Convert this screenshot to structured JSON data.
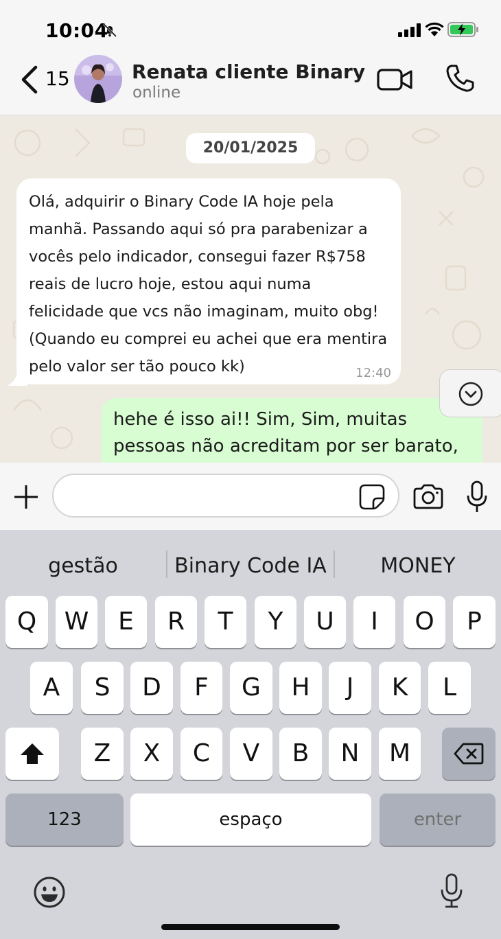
{
  "status_bar": {
    "time": "10:04"
  },
  "header": {
    "back_count": "15",
    "contact_name": "Renata cliente Binary",
    "contact_status": "online"
  },
  "chat": {
    "date": "20/01/2025",
    "incoming": {
      "text": "Olá, adquirir o Binary Code IA hoje pela manhã. Passando aqui só pra parabenizar a vocês pelo indicador, consegui fazer R$758 reais de lucro hoje, estou aqui numa felicidade que vcs não imaginam, muito obg! (Quando eu comprei eu achei que era mentira pelo valor ser tão pouco kk)",
      "time": "12:40"
    },
    "outgoing": {
      "text": "hehe é isso ai!! Sim, Sim, muitas pessoas não acreditam por ser barato,"
    }
  },
  "composer": {
    "value": ""
  },
  "keyboard": {
    "suggestions": [
      "gestão",
      "Binary Code IA",
      "MONEY"
    ],
    "row1": [
      "Q",
      "W",
      "E",
      "R",
      "T",
      "Y",
      "U",
      "I",
      "O",
      "P"
    ],
    "row2": [
      "A",
      "S",
      "D",
      "F",
      "G",
      "H",
      "J",
      "K",
      "L"
    ],
    "row3": [
      "Z",
      "X",
      "C",
      "V",
      "B",
      "N",
      "M"
    ],
    "numbers_label": "123",
    "space_label": "espaço",
    "enter_label": "enter"
  },
  "colors": {
    "incoming_bubble": "#ffffff",
    "outgoing_bubble": "#d9fdd3",
    "chat_background": "#efeae1",
    "keyboard_background": "#d3d5da",
    "battery_charging": "#34c759"
  },
  "icons": [
    "bell-slash-icon",
    "signal-icon",
    "wifi-icon",
    "battery-charging-icon",
    "back-chevron-icon",
    "video-call-icon",
    "phone-icon",
    "chevron-down-icon",
    "plus-icon",
    "sticker-icon",
    "camera-icon",
    "microphone-icon",
    "shift-icon",
    "backspace-icon",
    "emoji-icon"
  ]
}
